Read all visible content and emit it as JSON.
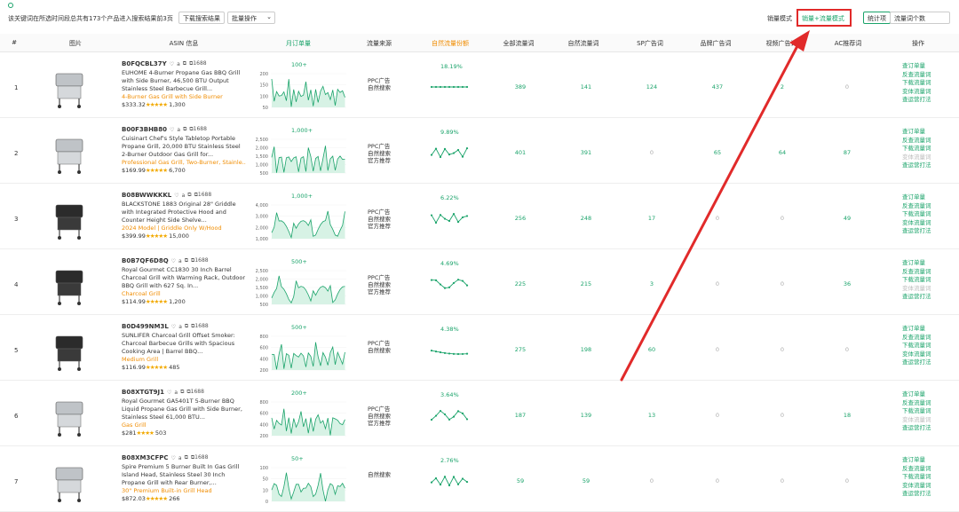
{
  "summary": "该关键词在所选时间段总共有173个产品进入搜索结果前3页",
  "download_btn": "下载搜索结果",
  "batch_btn": "批量操作",
  "batch_arrow": "⌄",
  "mode_sales": "销量模式",
  "mode_sales_traffic": "销量+流量模式",
  "stat_label": "统计项",
  "stat_select": "流量词个数",
  "columns": {
    "idx": "#",
    "image": "图片",
    "asin": "ASIN 信息",
    "monthly": "月订单量",
    "source": "流量来源",
    "organic_share": "自然流量份额",
    "all_words": "全部流量词",
    "organic_words": "自然流量词",
    "sp_words": "SP广告词",
    "brand_words": "品牌广告词",
    "video_words": "视频广告词",
    "ac_words": "AC推荐词",
    "actions": "操作"
  },
  "rows": [
    {
      "idx": "1",
      "asin": "B0FQCBL37Y",
      "title": "EUHOME 4-Burner Propane Gas BBQ Grill with Side Burner, 46,500 BTU Output Stainless Steel Barbecue Grill...",
      "cat": "4-Burner Gas Grill with Side Burner",
      "price": "$333.32",
      "stars": "★★★★★",
      "reviews": "1,300",
      "monthly": "100+",
      "ticks": [
        "200",
        "150",
        "100",
        "50"
      ],
      "src": [
        "PPC广告",
        "自然搜索"
      ],
      "share": "18.19%",
      "all": "389",
      "organic": "141",
      "sp": "124",
      "brand": "437",
      "video": "2",
      "ac": "0",
      "ops": [
        "查订单量",
        "反查流量词",
        "下载流量词",
        "变体流量词",
        "查运营打法"
      ],
      "dim": []
    },
    {
      "idx": "2",
      "asin": "B00F3BHB80",
      "title": "Cuisinart Chef's Style Tabletop Portable Propane Grill, 20,000 BTU Stainless Steel 2-Burner Outdoor Gas Grill for...",
      "cat": "Professional Gas Grill, Two-Burner, Stainle...",
      "price": "$169.99",
      "stars": "★★★★★",
      "reviews": "6,700",
      "monthly": "1,000+",
      "ticks": [
        "2,500",
        "2,000",
        "1,500",
        "1,000",
        "500"
      ],
      "src": [
        "PPC广告",
        "自然搜索",
        "官方推荐"
      ],
      "share": "9.89%",
      "all": "401",
      "organic": "391",
      "sp": "0",
      "brand": "65",
      "video": "64",
      "ac": "87",
      "ops": [
        "查订单量",
        "反查流量词",
        "下载流量词",
        "变体流量词",
        "查运营打法"
      ],
      "dim": [
        3
      ]
    },
    {
      "idx": "3",
      "asin": "B08BWWKKKL",
      "title": "BLACKSTONE 1883 Original 28\" Griddle with Integrated Protective Hood and Counter Height Side Shelve...",
      "cat": "2024 Model  |  Griddle Only W/Hood",
      "price": "$399.99",
      "stars": "★★★★★",
      "reviews": "15,000",
      "monthly": "1,000+",
      "ticks": [
        "4,000",
        "3,000",
        "2,000",
        "1,000"
      ],
      "src": [
        "PPC广告",
        "自然搜索",
        "官方推荐"
      ],
      "share": "6.22%",
      "all": "256",
      "organic": "248",
      "sp": "17",
      "brand": "0",
      "video": "0",
      "ac": "49",
      "ops": [
        "查订单量",
        "反查流量词",
        "下载流量词",
        "变体流量词",
        "查运营打法"
      ],
      "dim": []
    },
    {
      "idx": "4",
      "asin": "B0B7QF6D8Q",
      "title": "Royal Gourmet CC1830 30 Inch Barrel Charcoal Grill with Warming Rack, Outdoor BBQ Grill with 627 Sq. In...",
      "cat": "Charcoal Grill",
      "price": "$114.99",
      "stars": "★★★★★",
      "reviews": "1,200",
      "monthly": "500+",
      "ticks": [
        "2,500",
        "2,000",
        "1,500",
        "1,000",
        "500"
      ],
      "src": [
        "PPC广告",
        "自然搜索",
        "官方推荐"
      ],
      "share": "4.69%",
      "all": "225",
      "organic": "215",
      "sp": "3",
      "brand": "0",
      "video": "0",
      "ac": "36",
      "ops": [
        "查订单量",
        "反查流量词",
        "下载流量词",
        "变体流量词",
        "查运营打法"
      ],
      "dim": [
        3
      ]
    },
    {
      "idx": "5",
      "asin": "B0D499NM3L",
      "title": "SUNLIFER Charcoal Grill Offset Smoker: Charcoal Barbecue Grills with Spacious Cooking Area | Barrel BBQ...",
      "cat": "Medium Grill",
      "price": "$116.99",
      "stars": "★★★★★",
      "reviews": "485",
      "monthly": "500+",
      "ticks": [
        "800",
        "600",
        "400",
        "200"
      ],
      "src": [
        "PPC广告",
        "自然搜索"
      ],
      "share": "4.38%",
      "all": "275",
      "organic": "198",
      "sp": "60",
      "brand": "0",
      "video": "0",
      "ac": "0",
      "ops": [
        "查订单量",
        "反查流量词",
        "下载流量词",
        "变体流量词",
        "查运营打法"
      ],
      "dim": []
    },
    {
      "idx": "6",
      "asin": "B08XTGT9J1",
      "title": "Royal Gourmet GA5401T 5-Burner BBQ Liquid Propane Gas Grill with Side Burner, Stainless Steel 61,000 BTU...",
      "cat": "Gas Grill",
      "price": "$281",
      "stars": "★★★★",
      "reviews": "503",
      "monthly": "200+",
      "ticks": [
        "800",
        "600",
        "400",
        "200"
      ],
      "src": [
        "PPC广告",
        "自然搜索",
        "官方推荐"
      ],
      "share": "3.64%",
      "all": "187",
      "organic": "139",
      "sp": "13",
      "brand": "0",
      "video": "0",
      "ac": "18",
      "ops": [
        "查订单量",
        "反查流量词",
        "下载流量词",
        "变体流量词",
        "查运营打法"
      ],
      "dim": [
        3
      ]
    },
    {
      "idx": "7",
      "asin": "B08XM3CFPC",
      "title": "Spire Premium 5 Burner Built In Gas Grill Island Head, Stainless Steel 30 Inch Propane Grill with Rear Burner,...",
      "cat": "30\" Premium Built-in Grill Head",
      "price": "$872.03",
      "stars": "★★★★★",
      "reviews": "266",
      "monthly": "50+",
      "ticks": [
        "100",
        "50",
        "10",
        "0"
      ],
      "src": [
        "自然搜索"
      ],
      "share": "2.76%",
      "all": "59",
      "organic": "59",
      "sp": "0",
      "brand": "0",
      "video": "0",
      "ac": "0",
      "ops": [
        "查订单量",
        "反查流量词",
        "下载流量词",
        "变体流量词",
        "查运营打法"
      ],
      "dim": []
    }
  ],
  "colors": {
    "accent": "#1aa36a",
    "orange": "#f08c00",
    "red": "#e12a2a"
  }
}
